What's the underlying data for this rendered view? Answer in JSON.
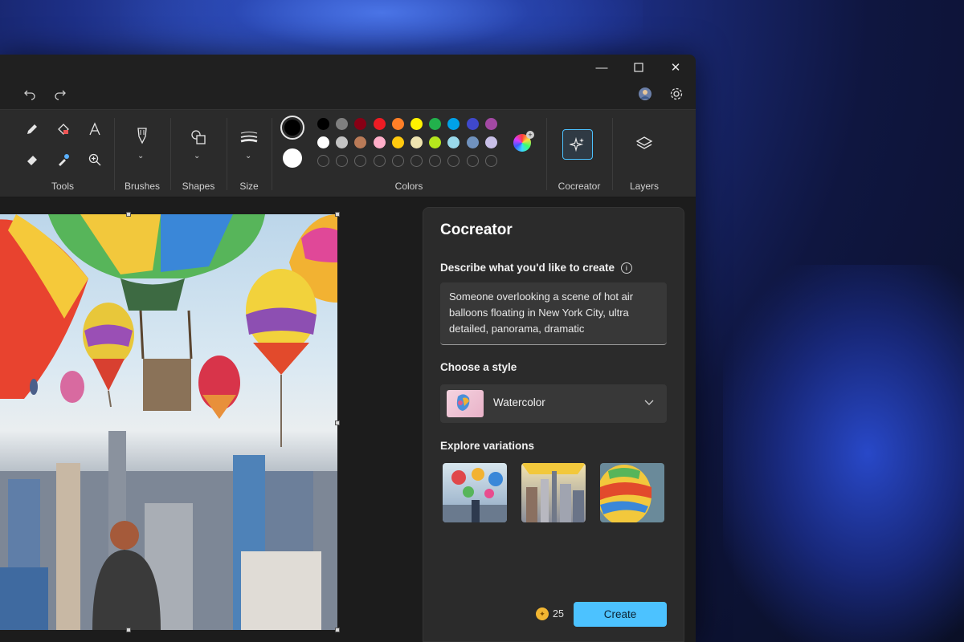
{
  "window": {
    "minimize_glyph": "—",
    "maximize_glyph": "☐",
    "close_glyph": "✕"
  },
  "ribbon": {
    "groups": {
      "tools": "Tools",
      "brushes": "Brushes",
      "shapes": "Shapes",
      "size": "Size",
      "colors": "Colors",
      "cocreator": "Cocreator",
      "layers": "Layers"
    },
    "palette_row1": [
      "#000000",
      "#7f7f7f",
      "#880015",
      "#ed1c24",
      "#ff7f27",
      "#fff200",
      "#22b14c",
      "#00a2e8",
      "#3f48cc",
      "#a349a4"
    ],
    "palette_row2": [
      "#ffffff",
      "#c3c3c3",
      "#b97a57",
      "#ffaec9",
      "#ffc90e",
      "#efe4b0",
      "#b5e61d",
      "#99d9ea",
      "#7092be",
      "#c8bfe7"
    ],
    "primary_color": "#000000",
    "secondary_color": "#ffffff"
  },
  "cocreator": {
    "title": "Cocreator",
    "describe_label": "Describe what you'd like to create",
    "prompt_text": "Someone overlooking a scene of hot air balloons floating in New York City, ultra detailed, panorama, dramatic",
    "style_label": "Choose a style",
    "style_value": "Watercolor",
    "variations_label": "Explore variations",
    "credits": "25",
    "create_label": "Create"
  },
  "colors": {
    "accent": "#4cc2ff",
    "panel_bg": "#2b2b2b",
    "window_bg": "#202020"
  }
}
